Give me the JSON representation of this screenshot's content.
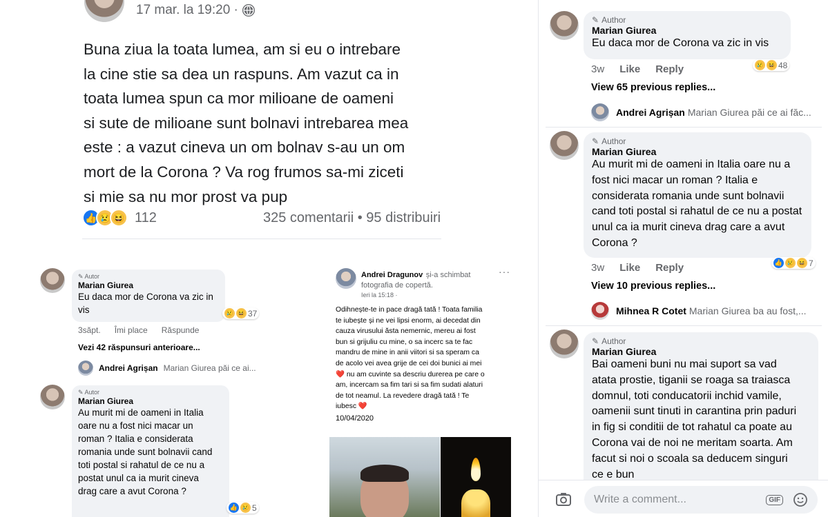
{
  "post": {
    "timestamp": "17 mar. la 19:20 ·",
    "globe_icon": "globe-icon",
    "text": "Buna ziua la toata lumea, am si eu o intrebare\nla cine stie sa dea un raspuns. Am vazut ca in\ntoata lumea spun ca mor milioane de oameni\nsi sute de milioane sunt bolnavi intrebarea mea\neste : a vazut cineva un om bolnav s-au un om\nmort de la Corona ? Va rog frumos sa-mi ziceti\nsi mie sa nu mor prost va pup",
    "reaction_count": "112",
    "comments_shares": "325 comentarii • 95 distribuiri"
  },
  "left_comments": [
    {
      "author_tag": "Autor",
      "name": "Marian Giurea",
      "text": "Eu daca mor de Corona va zic in vis",
      "reaction_count": "37",
      "actions": [
        "3săpt.",
        "Îmi place",
        "Răspunde"
      ],
      "view_more": "Vezi 42 răspunsuri anterioare...",
      "reply_name": "Andrei Agrișan",
      "reply_text": "Marian Giurea păi ce ai..."
    },
    {
      "author_tag": "Autor",
      "name": "Marian Giurea",
      "text": "Au murit mi de oameni in Italia oare nu a fost nici macar un roman ? Italia e considerata romania unde sunt bolnavii cand toti postal si rahatul de ce nu a postat unul ca ia murit cineva drag care a avut Corona ?",
      "reaction_count": "5"
    }
  ],
  "middle_card": {
    "name": "Andrei Dragunov",
    "action": "și-a schimbat fotografia de copertă.",
    "time": "Ieri la 15:18 ·",
    "text": "Odihnește-te in pace dragă tată ! Toata familia\nte iubește și ne vei lipsi enorm, ai decedat din\ncauza virusului ăsta nemernic, mereu ai fost\nbun si grijuliu cu mine, o sa incerc sa te fac\nmandru de mine in anii viitori si sa speram ca\nde acolo vei avea grije de cei doi bunici ai mei\n❤️ nu am cuvinte sa descriu durerea pe care o\nam, incercam sa fim tari si sa fim sudati alaturi\nde tot neamul. La revedere dragă tată ! Te\niubesc ❤️",
    "date": "10/04/2020"
  },
  "right_comments": [
    {
      "author_tag": "Author",
      "name": "Marian Giurea",
      "text": "Eu daca mor de Corona va zic in vis",
      "actions": [
        "3w",
        "Like",
        "Reply"
      ],
      "reaction_count": "48",
      "view_more": "View 65 previous replies...",
      "reply_name": "Andrei Agrișan",
      "reply_text": "Marian Giurea păi ce ai făc..."
    },
    {
      "author_tag": "Author",
      "name": "Marian Giurea",
      "text": "Au murit mi de oameni in Italia oare nu a fost nici macar un roman ? Italia e considerata romania unde sunt bolnavii cand toti postal si rahatul de ce nu a postat unul ca ia murit cineva drag care a avut Corona ?",
      "actions": [
        "3w",
        "Like",
        "Reply"
      ],
      "reaction_count": "7",
      "view_more": "View 10 previous replies...",
      "reply_name": "Mihnea R Cotet",
      "reply_text": "Marian Giurea ba au fost,..."
    },
    {
      "author_tag": "Author",
      "name": "Marian Giurea",
      "text": "Bai oameni buni nu mai suport sa vad atata prostie, tiganii se roaga sa traiasca domnul, toti conducatorii inchid vamile, oamenii sunt tinuti in carantina prin paduri in fig si conditii de tot rahatul ca poate au Corona vai de noi ne meritam soarta. Am facut si noi o scoala sa deducem singuri ce e bun"
    }
  ],
  "composer": {
    "placeholder": "Write a comment...",
    "gif_label": "GIF"
  }
}
